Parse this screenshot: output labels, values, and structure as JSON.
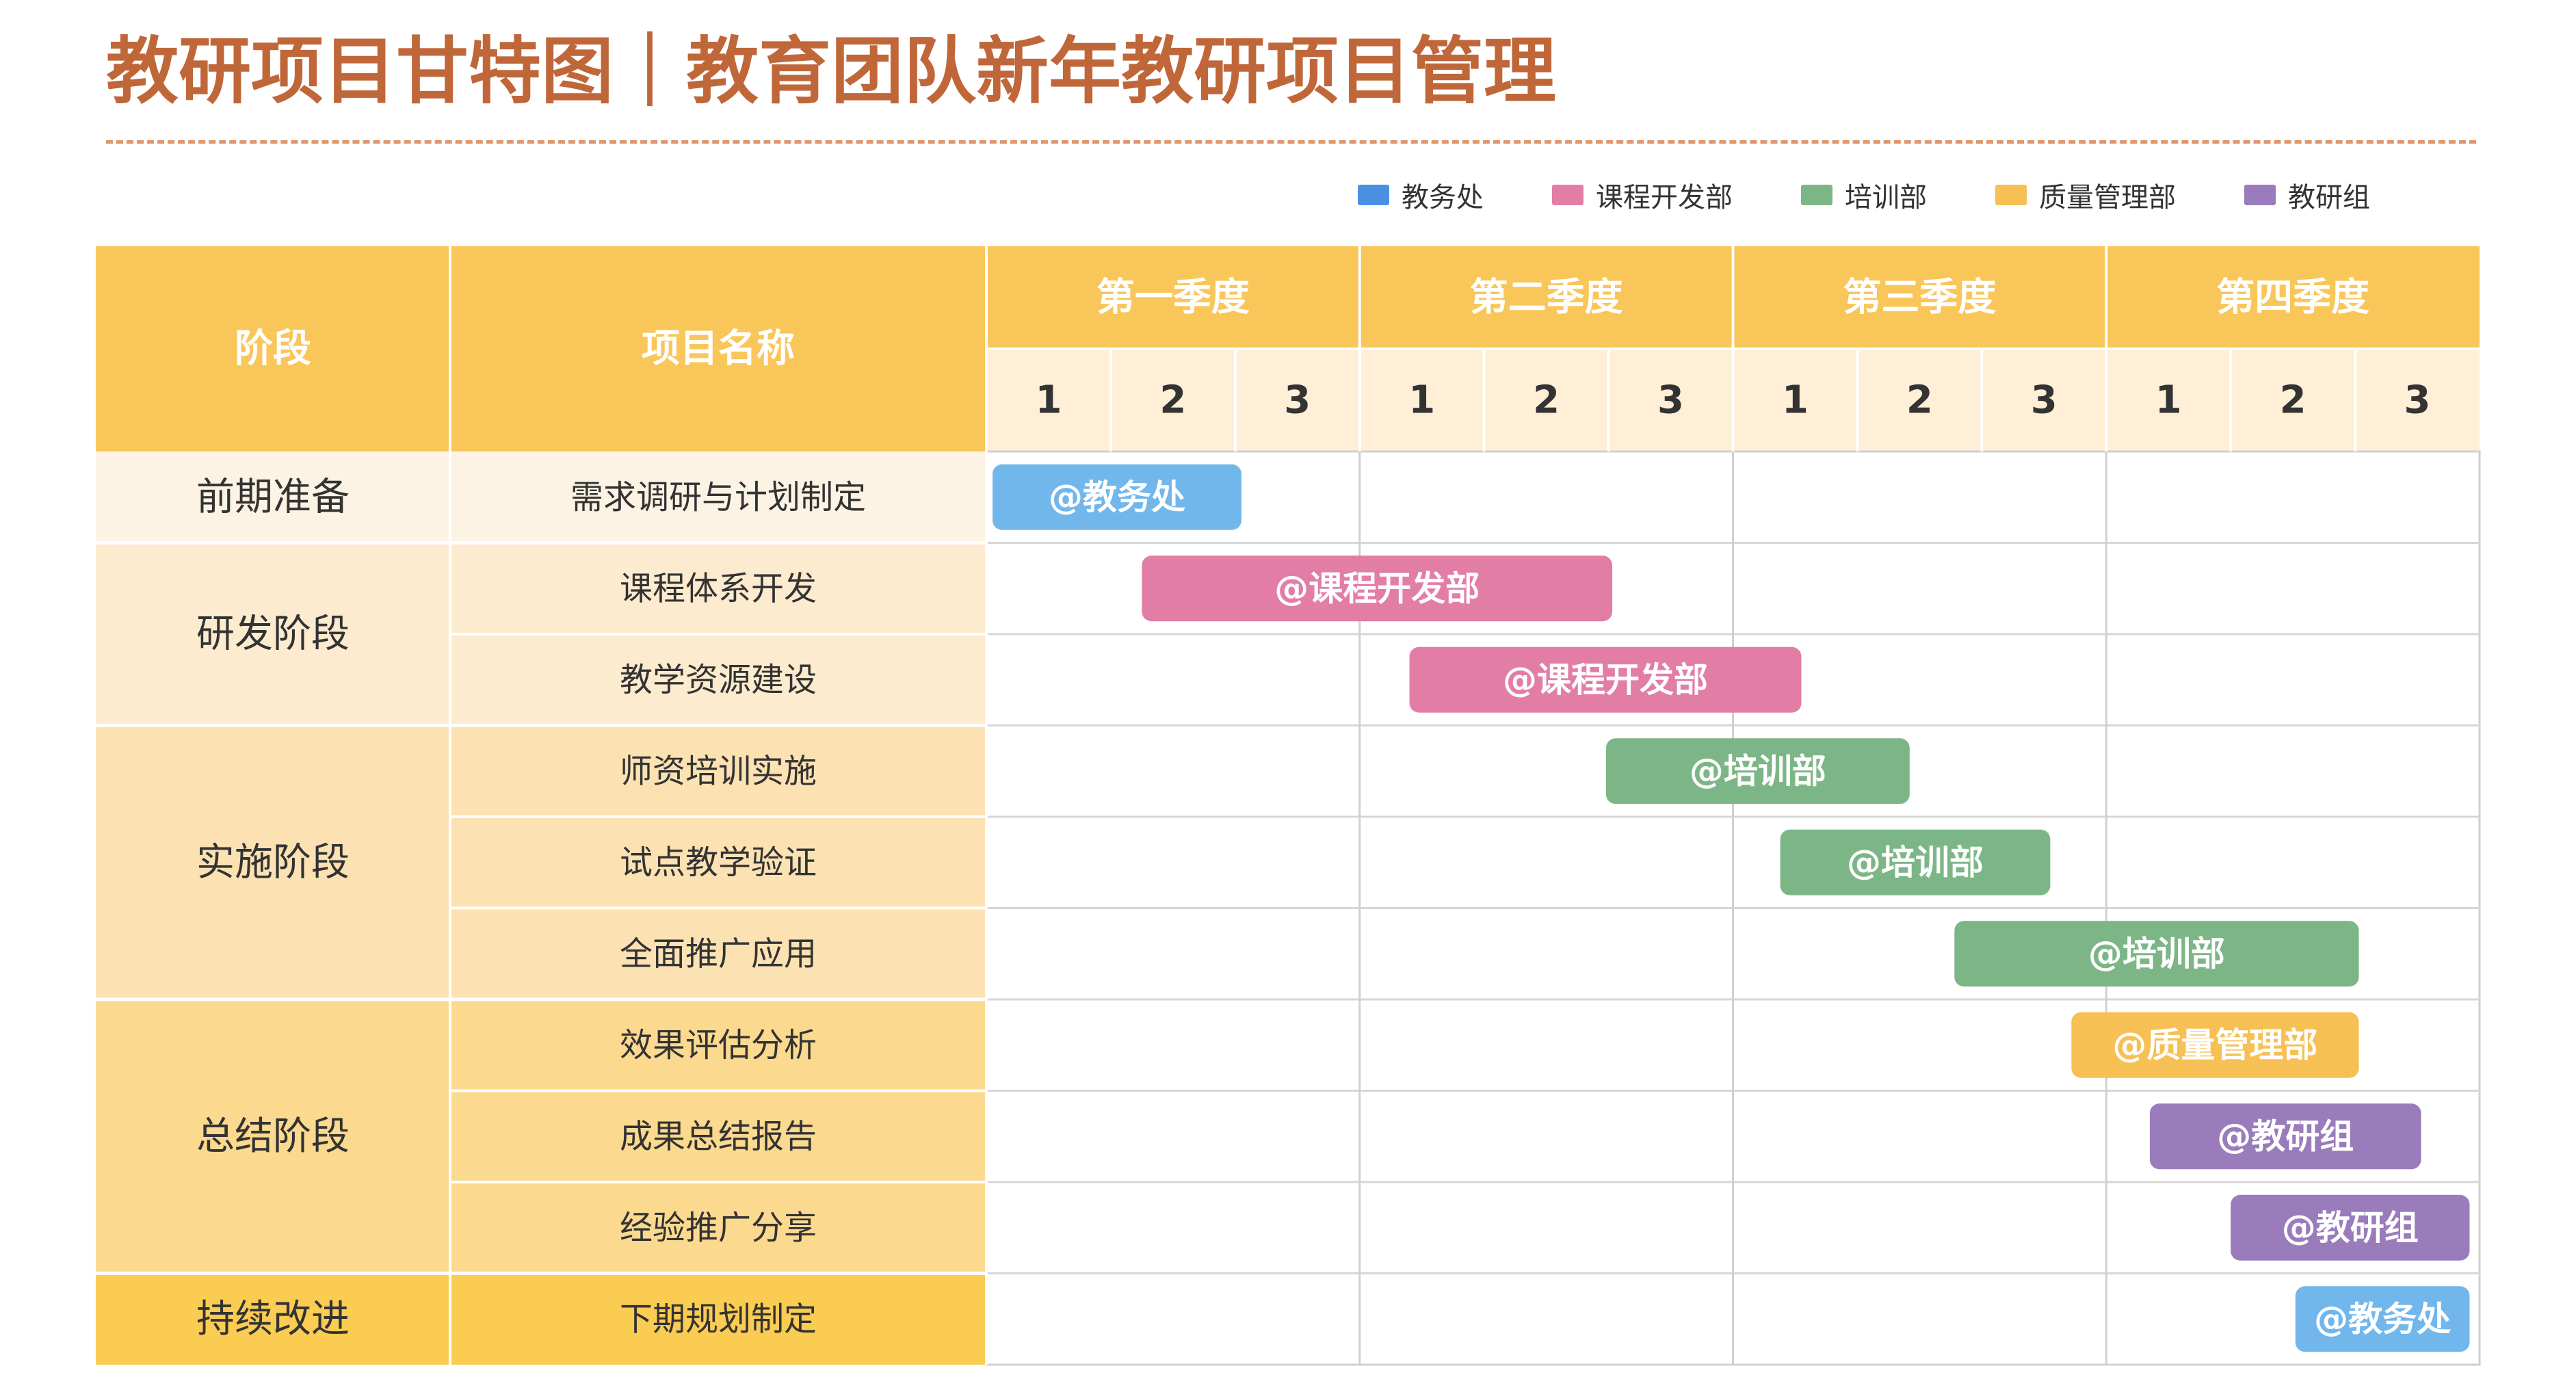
{
  "page_title": "教研项目甘特图｜教育团队新年教研项目管理",
  "legend": [
    {
      "name": "教务处",
      "color": "#4a90e2"
    },
    {
      "name": "课程开发部",
      "color": "#e27ea6"
    },
    {
      "name": "培训部",
      "color": "#7cb686"
    },
    {
      "name": "质量管理部",
      "color": "#f6c054"
    },
    {
      "name": "教研组",
      "color": "#9a7cbc"
    }
  ],
  "chart_data": {
    "type": "gantt",
    "header": {
      "stage": "阶段",
      "project": "项目名称"
    },
    "quarters": [
      "第一季度",
      "第二季度",
      "第三季度",
      "第四季度"
    ],
    "months": [
      "1",
      "2",
      "3",
      "1",
      "2",
      "3",
      "1",
      "2",
      "3",
      "1",
      "2",
      "3"
    ],
    "stages": [
      {
        "name": "前期准备",
        "rows": 1,
        "color": "#fdf3e4"
      },
      {
        "name": "研发阶段",
        "rows": 2,
        "color": "#fdebcf"
      },
      {
        "name": "实施阶段",
        "rows": 3,
        "color": "#fce2b3"
      },
      {
        "name": "总结阶段",
        "rows": 3,
        "color": "#fbd98f"
      },
      {
        "name": "持续改进",
        "rows": 1,
        "color": "#fbcc52"
      }
    ],
    "tasks": [
      {
        "name": "需求调研与计划制定",
        "label": "@教务处",
        "start": 0.05,
        "end": 2.05,
        "color": "#72b7ec"
      },
      {
        "name": "课程体系开发",
        "label": "@课程开发部",
        "start": 1.25,
        "end": 5.03,
        "color": "#e27ea6"
      },
      {
        "name": "教学资源建设",
        "label": "@课程开发部",
        "start": 3.4,
        "end": 6.55,
        "color": "#e27ea6"
      },
      {
        "name": "师资培训实施",
        "label": "@培训部",
        "start": 4.98,
        "end": 7.42,
        "color": "#7cb686"
      },
      {
        "name": "试点教学验证",
        "label": "@培训部",
        "start": 6.38,
        "end": 8.55,
        "color": "#7cb686"
      },
      {
        "name": "全面推广应用",
        "label": "@培训部",
        "start": 7.78,
        "end": 11.03,
        "color": "#7cb686"
      },
      {
        "name": "效果评估分析",
        "label": "@质量管理部",
        "start": 8.72,
        "end": 11.03,
        "color": "#f6c054"
      },
      {
        "name": "成果总结报告",
        "label": "@教研组",
        "start": 9.35,
        "end": 11.53,
        "color": "#9a7cbc"
      },
      {
        "name": "经验推广分享",
        "label": "@教研组",
        "start": 10.0,
        "end": 11.92,
        "color": "#9a7cbc"
      },
      {
        "name": "下期规划制定",
        "label": "@教务处",
        "start": 10.52,
        "end": 11.92,
        "color": "#72b7ec"
      }
    ]
  }
}
